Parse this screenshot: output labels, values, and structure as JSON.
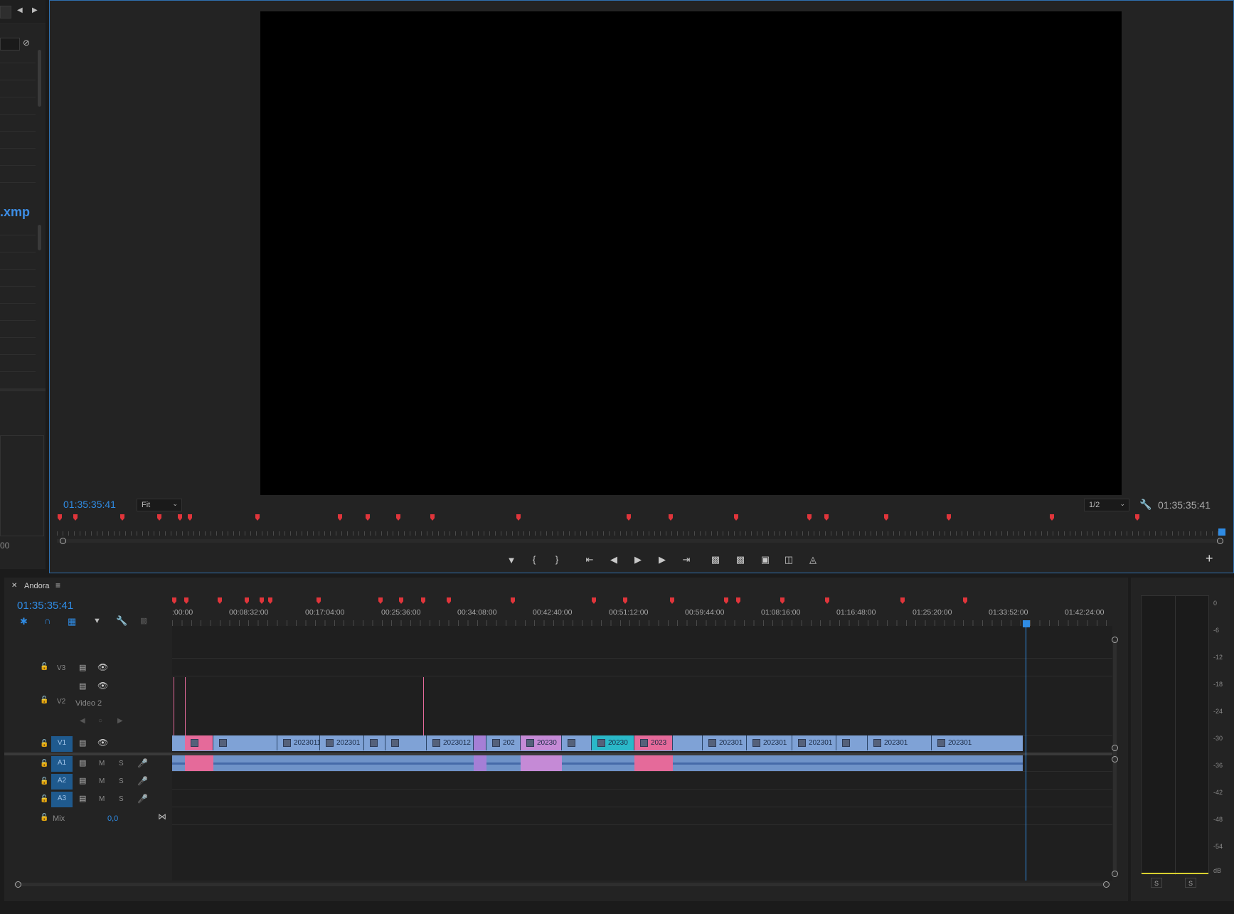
{
  "project_panel": {
    "xmp_label": ".xmp",
    "bottom_number": "00"
  },
  "program_monitor": {
    "current_timecode": "01:35:35:41",
    "zoom_select": "Fit",
    "resolution_select": "1/2",
    "duration_timecode": "01:35:35:41",
    "controls": [
      "marker-icon",
      "mark-in-icon",
      "mark-out-icon",
      "go-to-in-icon",
      "step-back-icon",
      "play-icon",
      "step-forward-icon",
      "go-to-out-icon",
      "lift-icon",
      "extract-icon",
      "export-frame-icon",
      "comparison-view-icon",
      "toggle-proxies-icon"
    ],
    "add_button": "+"
  },
  "timeline": {
    "sequence_name": "Andora",
    "current_timecode": "01:35:35:41",
    "ruler_labels": [
      ":00:00",
      "00:08:32:00",
      "00:17:04:00",
      "00:25:36:00",
      "00:34:08:00",
      "00:42:40:00",
      "00:51:12:00",
      "00:59:44:00",
      "01:08:16:00",
      "01:16:48:00",
      "01:25:20:00",
      "01:33:52:00",
      "01:42:24:00"
    ],
    "tracks": {
      "v3": {
        "label": "V3"
      },
      "v2": {
        "label": "V2",
        "name": "Video 2"
      },
      "v1": {
        "label": "V1"
      },
      "a1": {
        "label": "A1",
        "m": "M",
        "s": "S"
      },
      "a2": {
        "label": "A2",
        "m": "M",
        "s": "S"
      },
      "a3": {
        "label": "A3",
        "m": "M",
        "s": "S"
      },
      "mix": {
        "label": "Mix",
        "value": "0,0"
      }
    },
    "video_clips": [
      {
        "label": "",
        "color": "#e56a9a"
      },
      {
        "label": "",
        "color": "#7fa2d6"
      },
      {
        "label": "2023011",
        "color": "#7fa2d6"
      },
      {
        "label": "202301",
        "color": "#7fa2d6"
      },
      {
        "label": "",
        "color": "#7fa2d6"
      },
      {
        "label": "",
        "color": "#7fa2d6"
      },
      {
        "label": "2023012",
        "color": "#7fa2d6"
      },
      {
        "label": "",
        "color": "#a57fd6"
      },
      {
        "label": "202",
        "color": "#7fa2d6"
      },
      {
        "label": "20230",
        "color": "#c58ad6"
      },
      {
        "label": "",
        "color": "#7fa2d6"
      },
      {
        "label": "20230",
        "color": "#2ab8c8"
      },
      {
        "label": "2023",
        "color": "#e56a9a"
      },
      {
        "label": "",
        "color": "#7fa2d6"
      },
      {
        "label": "202301",
        "color": "#7fa2d6"
      },
      {
        "label": "202301",
        "color": "#7fa2d6"
      },
      {
        "label": "202301",
        "color": "#7fa2d6"
      },
      {
        "label": "",
        "color": "#7fa2d6"
      },
      {
        "label": "202301",
        "color": "#7fa2d6"
      },
      {
        "label": "202301",
        "color": "#7fa2d6"
      }
    ]
  },
  "audio_meter": {
    "scale": [
      "0",
      "-6",
      "-12",
      "-18",
      "-24",
      "-30",
      "-36",
      "-42",
      "-48",
      "-54",
      "dB"
    ],
    "solo_left": "S",
    "solo_right": "S"
  }
}
